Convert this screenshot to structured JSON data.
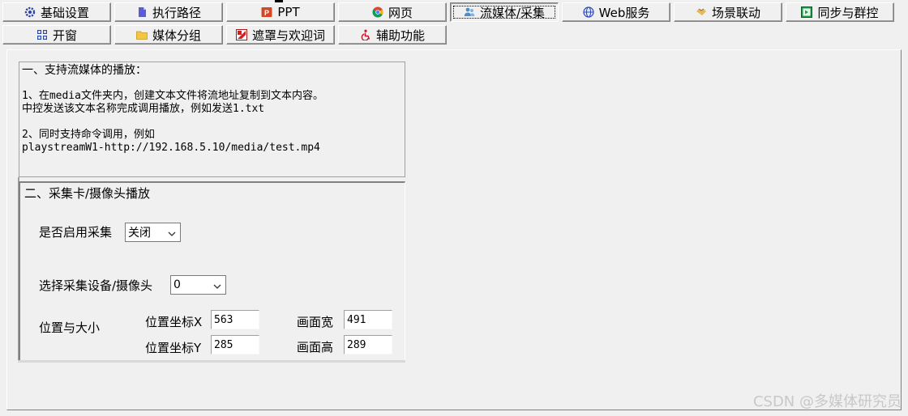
{
  "tabs": {
    "row1": [
      {
        "label": "基础设置",
        "icon": "gear-icon"
      },
      {
        "label": "执行路径",
        "icon": "document-icon"
      },
      {
        "label": "PPT",
        "icon": "powerpoint-icon"
      },
      {
        "label": "网页",
        "icon": "chrome-icon"
      },
      {
        "label": "流媒体/采集",
        "icon": "users-icon",
        "active": true
      },
      {
        "label": "Web服务",
        "icon": "globe-icon"
      },
      {
        "label": "场景联动",
        "icon": "handshake-icon"
      },
      {
        "label": "同步与群控",
        "icon": "play-icon"
      }
    ],
    "row2": [
      {
        "label": "开窗",
        "icon": "grid-icon"
      },
      {
        "label": "媒体分组",
        "icon": "folder-icon"
      },
      {
        "label": "遮罩与欢迎词",
        "icon": "mask-icon"
      },
      {
        "label": "辅助功能",
        "icon": "accessibility-icon"
      }
    ]
  },
  "stream": {
    "lines": [
      "一、支持流媒体的播放：",
      "",
      "1、在media文件夹内，创建文本文件将流地址复制到文本内容。",
      "中控发送该文本名称完成调用播放，例如发送1.txt",
      "",
      "2、同时支持命令调用，例如",
      "playstreamW1-http://192.168.5.10/media/test.mp4"
    ]
  },
  "capture": {
    "title": "二、采集卡/摄像头播放",
    "enable_label": "是否启用采集",
    "enable_value": "关闭",
    "device_label": "选择采集设备/摄像头",
    "device_value": "0",
    "pos_size_label": "位置与大小",
    "pos_x_label": "位置坐标X",
    "pos_x_value": "563",
    "pos_y_label": "位置坐标Y",
    "pos_y_value": "285",
    "width_label": "画面宽",
    "width_value": "491",
    "height_label": "画面高",
    "height_value": "289"
  },
  "watermark": "CSDN @多媒体研究员"
}
